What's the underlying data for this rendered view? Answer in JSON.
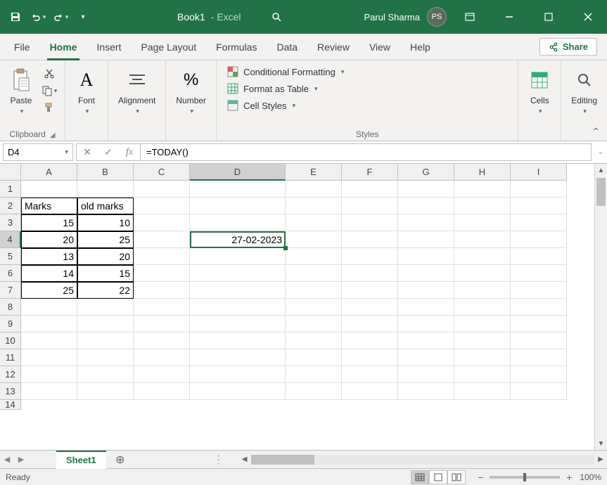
{
  "titlebar": {
    "doc_name": "Book1",
    "app_suffix": " - Excel",
    "user_name": "Parul Sharma",
    "user_initials": "PS"
  },
  "menu": {
    "file": "File",
    "home": "Home",
    "insert": "Insert",
    "page_layout": "Page Layout",
    "formulas": "Formulas",
    "data": "Data",
    "review": "Review",
    "view": "View",
    "help": "Help",
    "share": "Share"
  },
  "ribbon": {
    "clipboard": {
      "paste": "Paste",
      "label": "Clipboard"
    },
    "font": {
      "btn": "Font",
      "label": ""
    },
    "alignment": {
      "btn": "Alignment",
      "label": ""
    },
    "number": {
      "btn": "Number",
      "label": ""
    },
    "styles": {
      "conditional": "Conditional Formatting",
      "table": "Format as Table",
      "cell_styles": "Cell Styles",
      "label": "Styles"
    },
    "cells": {
      "btn": "Cells",
      "label": ""
    },
    "editing": {
      "btn": "Editing",
      "label": ""
    }
  },
  "formula_bar": {
    "cell_ref": "D4",
    "formula": "=TODAY()"
  },
  "grid": {
    "columns": [
      "A",
      "B",
      "C",
      "D",
      "E",
      "F",
      "G",
      "H",
      "I"
    ],
    "selected_col": "D",
    "selected_row": 4,
    "rows": [
      1,
      2,
      3,
      4,
      5,
      6,
      7,
      8,
      9,
      10,
      11,
      12,
      13,
      14
    ],
    "data": {
      "A2": "Marks",
      "B2": "old marks",
      "A3": "15",
      "B3": "10",
      "A4": "20",
      "B4": "25",
      "A5": "13",
      "B5": "20",
      "A6": "14",
      "B6": "15",
      "A7": "25",
      "B7": "22",
      "D4": "27-02-2023"
    }
  },
  "sheet": {
    "name": "Sheet1"
  },
  "status": {
    "ready": "Ready",
    "zoom": "100%"
  },
  "chart_data": {
    "type": "table",
    "title": "",
    "columns": [
      "Marks",
      "old marks"
    ],
    "rows": [
      [
        15,
        10
      ],
      [
        20,
        25
      ],
      [
        13,
        20
      ],
      [
        14,
        15
      ],
      [
        25,
        22
      ]
    ]
  }
}
